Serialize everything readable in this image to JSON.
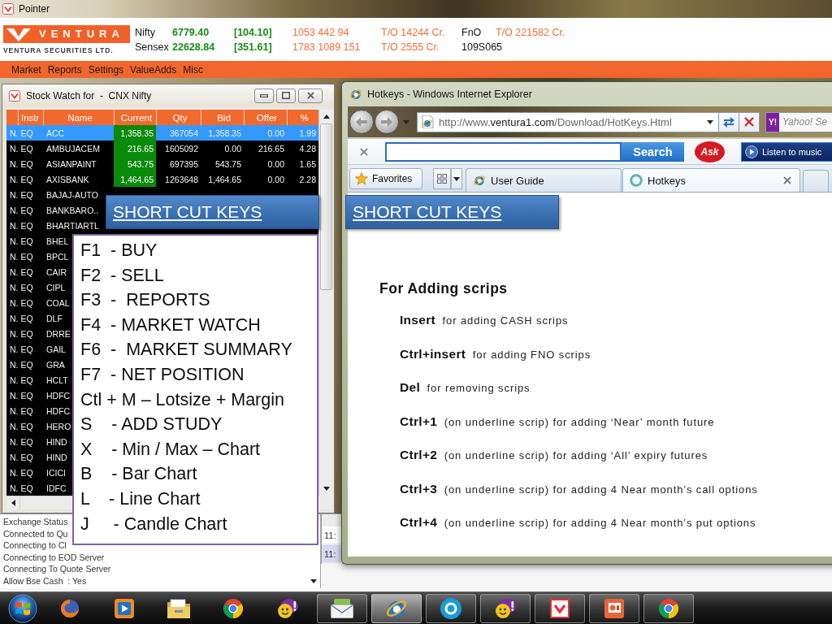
{
  "app_window": {
    "title": "Pointer"
  },
  "header": {
    "logo": {
      "wordmark": "VENTURA",
      "tagline": "VENTURA SECURITIES LTD."
    },
    "tickers": [
      {
        "index": "Nifty",
        "value": "6779.40",
        "change": "[104.10]",
        "volume": "1053 442 94",
        "turnover": "T/O 14244 Cr.",
        "segment": "FnO",
        "segment_turnover": "T/O 221582 Cr."
      },
      {
        "index": "Sensex",
        "value": "22628.84",
        "change": "[351.61]",
        "volume": "1783 1089 151",
        "turnover": "T/O 2555 Cr.",
        "segment": "109S065"
      }
    ]
  },
  "menu": [
    "Market",
    "Reports",
    "Settings",
    "ValueAdds",
    "Misc"
  ],
  "stock_watch": {
    "title": "Stock Watch for  -  CNX Nifty",
    "columns": [
      "Instr",
      "Name",
      "Current",
      "Qty",
      "Bid",
      "Offer",
      "%"
    ],
    "rows": [
      {
        "instr": "N. EQ",
        "name": "ACC",
        "current": "1,358.35",
        "qty": "367054",
        "bid": "1,358.35",
        "offer": "0.00",
        "pct": "1.99",
        "selected": true
      },
      {
        "instr": "N. EQ",
        "name": "AMBUJACEM",
        "current": "216.65",
        "qty": "1605092",
        "bid": "0.00",
        "offer": "216.65",
        "pct": "4.28",
        "selected": false
      },
      {
        "instr": "N. EQ",
        "name": "ASIANPAINT",
        "current": "543.75",
        "qty": "697395",
        "bid": "543.75",
        "offer": "0.00",
        "pct": "1.65",
        "selected": false
      },
      {
        "instr": "N. EQ",
        "name": "AXISBANK",
        "current": "1,464.65",
        "qty": "1263648",
        "bid": "1,464.65",
        "offer": "0.00",
        "pct": "2.28",
        "selected": false
      },
      {
        "instr": "N. EQ",
        "name": "BAJAJ-AUTO",
        "selected": false
      },
      {
        "instr": "N. EQ",
        "name": "BANKBARO..",
        "selected": false
      },
      {
        "instr": "N. EQ",
        "name": "BHARTIARTL",
        "selected": false
      },
      {
        "instr": "N. EQ",
        "name": "BHEL",
        "selected": false
      },
      {
        "instr": "N. EQ",
        "name": "BPCL",
        "selected": false
      },
      {
        "instr": "N. EQ",
        "name": "CAIR",
        "selected": false
      },
      {
        "instr": "N. EQ",
        "name": "CIPL",
        "selected": false
      },
      {
        "instr": "N. EQ",
        "name": "COAL",
        "selected": false
      },
      {
        "instr": "N. EQ",
        "name": "DLF",
        "selected": false
      },
      {
        "instr": "N. EQ",
        "name": "DRRE",
        "selected": false
      },
      {
        "instr": "N. EQ",
        "name": "GAIL",
        "selected": false
      },
      {
        "instr": "N. EQ",
        "name": "GRA",
        "selected": false
      },
      {
        "instr": "N. EQ",
        "name": "HCLT",
        "selected": false
      },
      {
        "instr": "N. EQ",
        "name": "HDFC",
        "selected": false
      },
      {
        "instr": "N. EQ",
        "name": "HDFC",
        "selected": false
      },
      {
        "instr": "N. EQ",
        "name": "HERO",
        "selected": false
      },
      {
        "instr": "N. EQ",
        "name": "HIND",
        "selected": false
      },
      {
        "instr": "N. EQ",
        "name": "HIND",
        "selected": false
      },
      {
        "instr": "N. EQ",
        "name": "ICICI",
        "selected": false
      },
      {
        "instr": "N. EQ",
        "name": "IDFC",
        "selected": false
      }
    ]
  },
  "message_log": [
    "Exchange Status",
    "Connected to Qu",
    "Connecting to Cl",
    "Connecting to EOD Server",
    "Connecting To Quote Server",
    "Allow Bse Cash  : Yes"
  ],
  "time_column": [
    {
      "text": "11:",
      "selected": false
    },
    {
      "text": "11:",
      "selected": true
    }
  ],
  "browser": {
    "title": "Hotkeys - Windows Internet Explorer",
    "address": {
      "scheme": "http://www.",
      "domain": "ventura1.com",
      "path": "/Download/HotKeys.Html"
    },
    "search_box": {
      "badge": "Y!",
      "placeholder": "Yahoo! Se"
    },
    "toolbar": {
      "search_button": "Search",
      "logo": "Ask",
      "music_button": "Listen to music"
    },
    "favorites_button": "Favorites",
    "tabs": [
      {
        "label": "User Guide",
        "selected": false
      },
      {
        "label": "Hotkeys",
        "selected": true
      }
    ],
    "page": {
      "heading": "For Adding scrips",
      "shortcuts": [
        {
          "key": "Insert",
          "description": "for adding CASH scrips"
        },
        {
          "key": "Ctrl+insert",
          "description": "for adding FNO scrips"
        },
        {
          "key": "Del",
          "description": "for removing scrips"
        },
        {
          "key": "Ctrl+1",
          "description": "(on underline scrip) for adding ‘Near’ month future"
        },
        {
          "key": "Ctrl+2",
          "description": "(on underline scrip) for adding ‘All’ expiry futures"
        },
        {
          "key": "Ctrl+3",
          "description": "(on underline scrip) for adding 4 Near month’s call options"
        },
        {
          "key": "Ctrl+4",
          "description": "(on underline scrip) for adding 4 Near month’s put options"
        }
      ]
    }
  },
  "overlays": {
    "banners": [
      "SHORT CUT KEYS",
      "SHORT CUT KEYS"
    ],
    "shortcut_list": [
      "F1  - BUY",
      "F2  - SELL",
      "F3  -  REPORTS",
      "F4  - MARKET WATCH",
      "F6  -  MARKET SUMMARY",
      "F7  - NET POSITION",
      "Ctl + M – Lotsize + Margin",
      "S    - ADD STUDY",
      "X    - Min / Max – Chart",
      "B    - Bar Chart",
      "L    - Line Chart",
      "J     - Candle Chart"
    ]
  },
  "taskbar": {
    "buttons": [
      {
        "running": false,
        "selected": false
      },
      {
        "running": false,
        "selected": false
      },
      {
        "running": false,
        "selected": false
      },
      {
        "running": false,
        "selected": false
      },
      {
        "running": false,
        "selected": false
      },
      {
        "running": true,
        "selected": false
      },
      {
        "running": true,
        "selected": true
      },
      {
        "running": true,
        "selected": false
      },
      {
        "running": true,
        "selected": false
      },
      {
        "running": true,
        "selected": false
      },
      {
        "running": true,
        "selected": false
      },
      {
        "running": true,
        "selected": false
      }
    ]
  }
}
